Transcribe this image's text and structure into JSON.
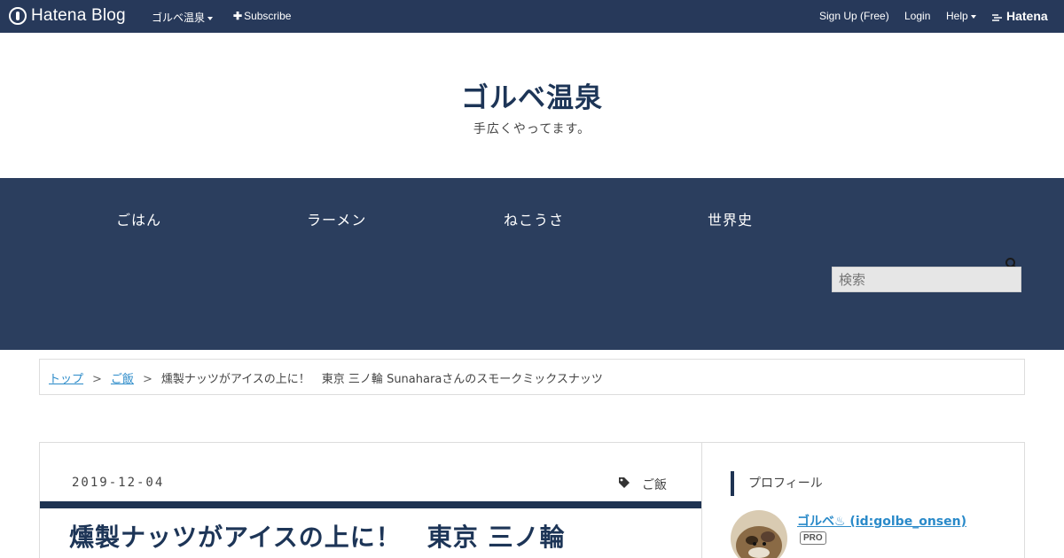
{
  "topbar": {
    "logo_text": "Hatena Blog",
    "blog_menu": "ゴルベ温泉",
    "subscribe": "Subscribe",
    "signup": "Sign Up (Free)",
    "login": "Login",
    "help": "Help",
    "brand": "Hatena"
  },
  "header": {
    "title": "ゴルベ温泉",
    "description": "手広くやってます。"
  },
  "nav": {
    "items": [
      "ごはん",
      "ラーメン",
      "ねこうさ",
      "世界史"
    ],
    "search_placeholder": "検索"
  },
  "breadcrumb": {
    "top": "トップ",
    "category": "ご飯",
    "current": "燻製ナッツがアイスの上に！　東京 三ノ輪 Sunaharaさんのスモークミックスナッツ",
    "separator": ">"
  },
  "entry": {
    "date": "2019-12-04",
    "category": "ご飯",
    "title": "燻製ナッツがアイスの上に！　東京 三ノ輪"
  },
  "sidebar": {
    "heading": "プロフィール",
    "profile_name": "ゴルベ♨ (id:golbe_onsen)",
    "badge": "PRO"
  },
  "colors": {
    "topbar": "#27395a",
    "nav_block": "#2b3e5e",
    "title": "#1d3557",
    "link": "#2a8ac9"
  }
}
